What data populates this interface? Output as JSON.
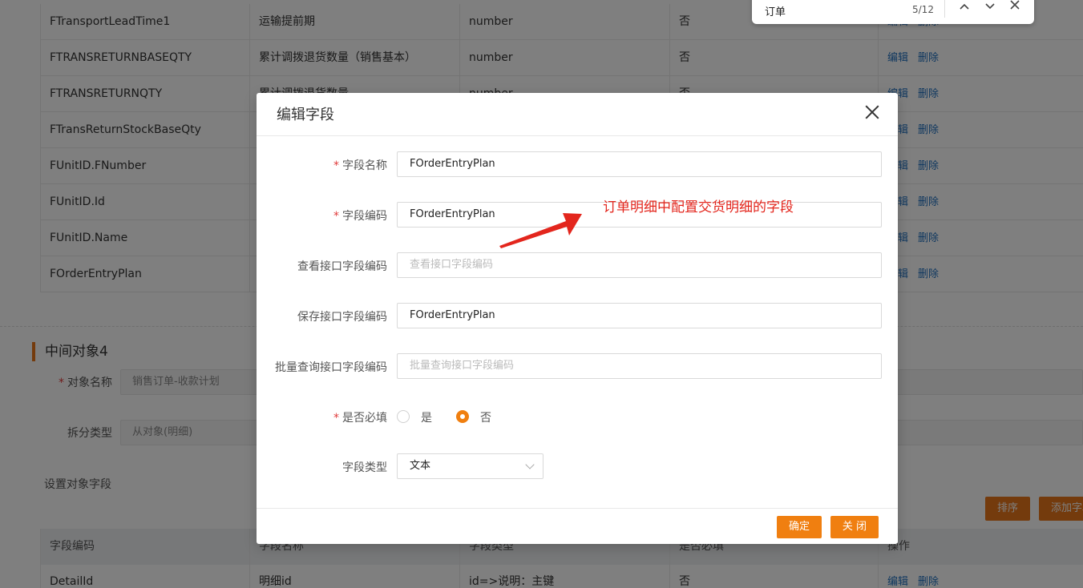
{
  "table_rows": [
    {
      "code": "FTransportLeadTime1",
      "name": "运输提前期",
      "type": "number",
      "required": "否"
    },
    {
      "code": "FTRANSRETURNBASEQTY",
      "name": "累计调拨退货数量（销售基本）",
      "type": "number",
      "required": "否"
    },
    {
      "code": "FTRANSRETURNQTY",
      "name": "累计调拨退货数量",
      "type": "number",
      "required": "否"
    },
    {
      "code": "FTransReturnStockBaseQty",
      "name": "",
      "type": "",
      "required": ""
    },
    {
      "code": "FUnitID.FNumber",
      "name": "",
      "type": "",
      "required": ""
    },
    {
      "code": "FUnitID.Id",
      "name": "",
      "type": "",
      "required": ""
    },
    {
      "code": "FUnitID.Name",
      "name": "",
      "type": "",
      "required": ""
    },
    {
      "code": "FOrderEntryPlan",
      "name": "",
      "type": "",
      "required": ""
    }
  ],
  "row_actions": {
    "edit": "编辑",
    "delete": "删除"
  },
  "section": {
    "title": "中间对象4",
    "object_name_label": "对象名称",
    "object_name_value": "销售订单-收款计划",
    "split_type_label": "拆分类型",
    "split_type_value": "从对象(明细)",
    "set_fields_label": "设置对象字段",
    "sort_button": "排序",
    "add_field_button": "添加字段"
  },
  "lower_table": {
    "headers": [
      "字段编码",
      "字段名称",
      "字段类型",
      "是否必填",
      "操作"
    ],
    "rows": [
      {
        "code": "DetailId",
        "name": "明细id",
        "type": "id=>说明：主键",
        "required": "否"
      }
    ]
  },
  "findbar": {
    "query": "订单",
    "count": "5/12"
  },
  "modal": {
    "title": "编辑字段",
    "fields": {
      "field_name_label": "字段名称",
      "field_name_value": "FOrderEntryPlan",
      "field_code_label": "字段编码",
      "field_code_value": "FOrderEntryPlan",
      "view_api_label": "查看接口字段编码",
      "view_api_placeholder": "查看接口字段编码",
      "save_api_label": "保存接口字段编码",
      "save_api_value": "FOrderEntryPlan",
      "batch_api_label": "批量查询接口字段编码",
      "batch_api_placeholder": "批量查询接口字段编码",
      "required_label": "是否必填",
      "required_yes": "是",
      "required_no": "否",
      "required_selected": "否",
      "field_type_label": "字段类型",
      "field_type_value": "文本"
    },
    "confirm": "确定",
    "close": "关 闭"
  },
  "annotation": "订单明细中配置交货明细的字段",
  "colors": {
    "accent": "#f07f10",
    "link": "#1e6fbf",
    "annotation": "#e3261d"
  }
}
